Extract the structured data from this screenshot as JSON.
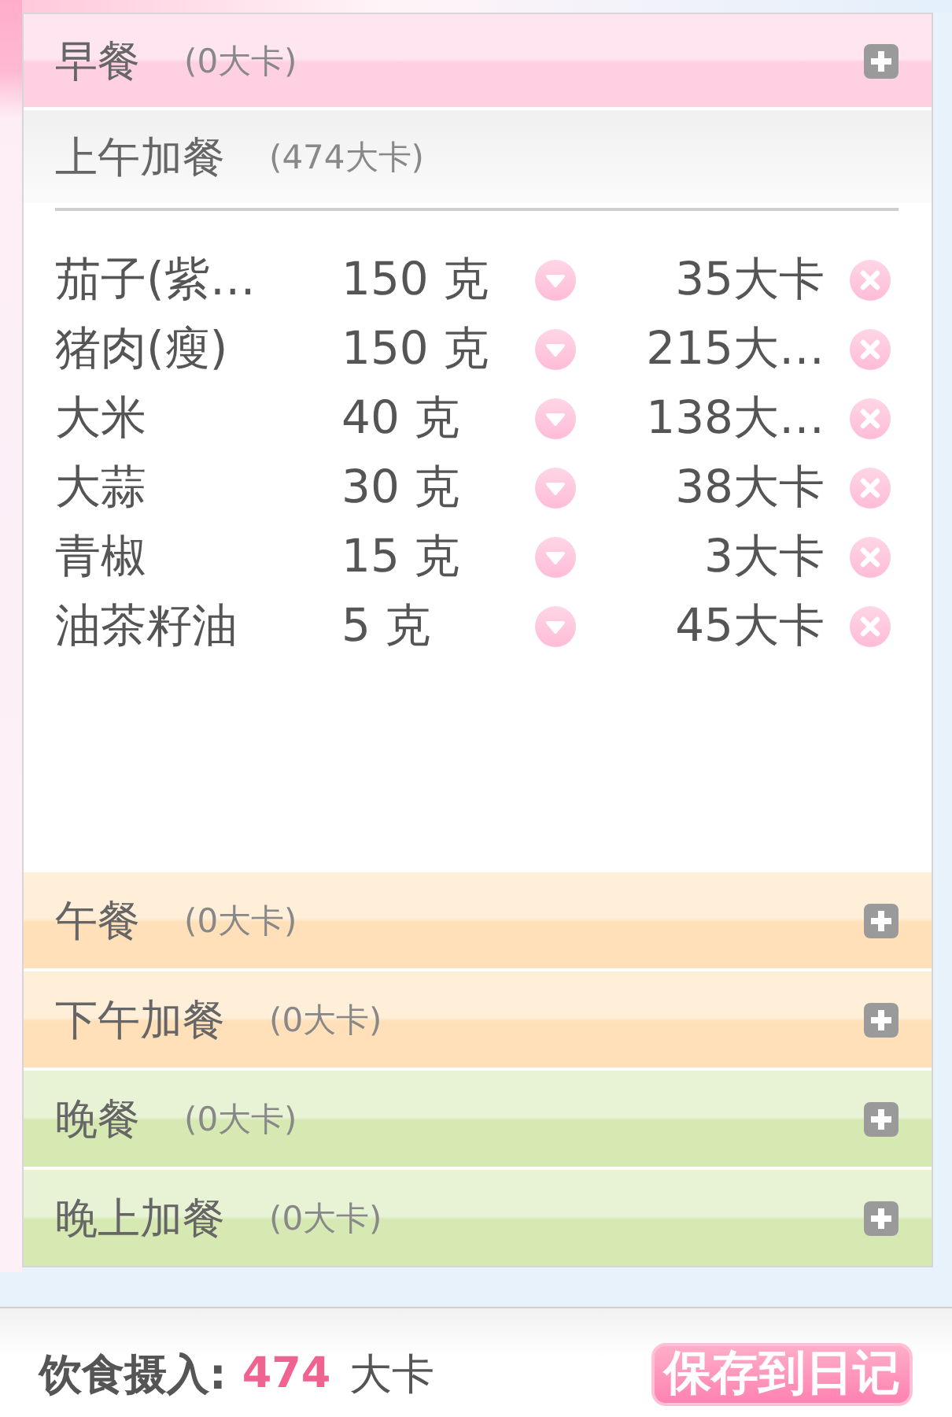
{
  "meals": [
    {
      "name": "早餐",
      "calories": "(0大卡)",
      "expanded": false,
      "color": "#ffd0e2"
    },
    {
      "name": "上午加餐",
      "calories": "(474大卡)",
      "expanded": true,
      "foods": [
        {
          "name": "茄子(紫…",
          "amount": "150 克",
          "calories": "35大卡"
        },
        {
          "name": "猪肉(瘦)",
          "amount": "150 克",
          "calories": "215大…"
        },
        {
          "name": "大米",
          "amount": "40 克",
          "calories": "138大…"
        },
        {
          "name": "大蒜",
          "amount": "30 克",
          "calories": "38大卡"
        },
        {
          "name": "青椒",
          "amount": "15 克",
          "calories": "3大卡"
        },
        {
          "name": "油茶籽油",
          "amount": "5 克",
          "calories": "45大卡"
        }
      ]
    },
    {
      "name": "午餐",
      "calories": "(0大卡)",
      "expanded": false,
      "color": "#ffe0b8"
    },
    {
      "name": "下午加餐",
      "calories": "(0大卡)",
      "expanded": false,
      "color": "#ffe0b8"
    },
    {
      "name": "晚餐",
      "calories": "(0大卡)",
      "expanded": false,
      "color": "#d6e9b3"
    },
    {
      "name": "晚上加餐",
      "calories": "(0大卡)",
      "expanded": false,
      "color": "#d6e9b3"
    }
  ],
  "summary": {
    "label": "饮食摄入:",
    "value": "474",
    "unit": "大卡"
  },
  "save_button": "保存到日记"
}
